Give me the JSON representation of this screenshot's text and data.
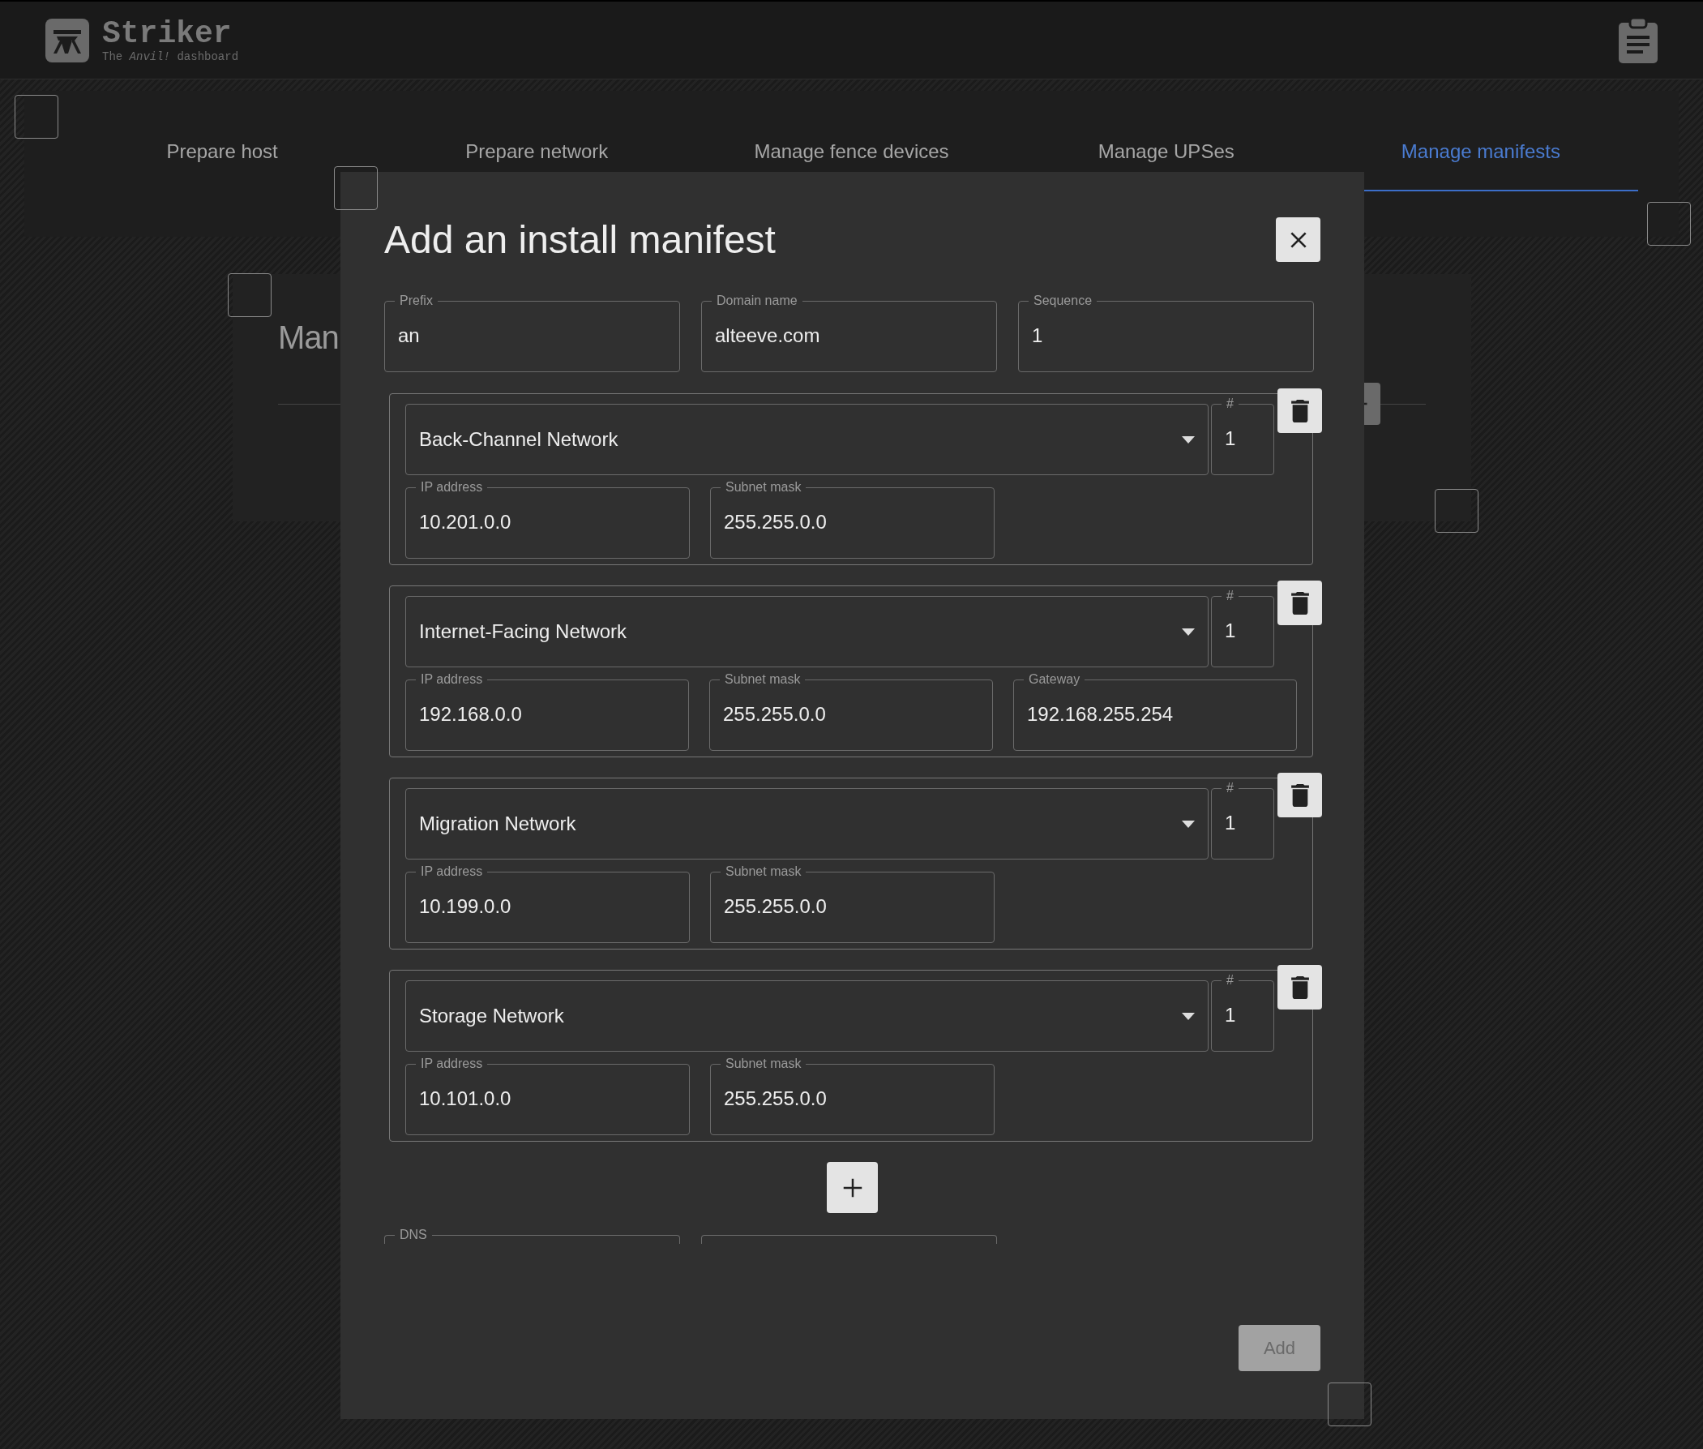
{
  "header": {
    "title": "Striker",
    "subtitle": "The *Anvil!* dashboard"
  },
  "tabs": [
    {
      "label": "Prepare host",
      "selected": false
    },
    {
      "label": "Prepare network",
      "selected": false
    },
    {
      "label": "Manage fence devices",
      "selected": false
    },
    {
      "label": "Manage UPSes",
      "selected": false
    },
    {
      "label": "Manage manifests",
      "selected": true
    }
  ],
  "panel": {
    "title": "Man"
  },
  "dialog": {
    "title": "Add an install manifest",
    "fields": [
      {
        "label": "Prefix",
        "value": "an"
      },
      {
        "label": "Domain name",
        "value": "alteeve.com"
      },
      {
        "label": "Sequence",
        "value": "1"
      }
    ],
    "networks": [
      {
        "type": "Back-Channel Network",
        "number_label": "#",
        "number": "1",
        "fields": [
          {
            "label": "IP address",
            "value": "10.201.0.0"
          },
          {
            "label": "Subnet mask",
            "value": "255.255.0.0"
          }
        ]
      },
      {
        "type": "Internet-Facing Network",
        "number_label": "#",
        "number": "1",
        "fields": [
          {
            "label": "IP address",
            "value": "192.168.0.0"
          },
          {
            "label": "Subnet mask",
            "value": "255.255.0.0"
          },
          {
            "label": "Gateway",
            "value": "192.168.255.254"
          }
        ]
      },
      {
        "type": "Migration Network",
        "number_label": "#",
        "number": "1",
        "fields": [
          {
            "label": "IP address",
            "value": "10.199.0.0"
          },
          {
            "label": "Subnet mask",
            "value": "255.255.0.0"
          }
        ]
      },
      {
        "type": "Storage Network",
        "number_label": "#",
        "number": "1",
        "fields": [
          {
            "label": "IP address",
            "value": "10.101.0.0"
          },
          {
            "label": "Subnet mask",
            "value": "255.255.0.0"
          }
        ]
      }
    ],
    "dns": {
      "label": "DNS"
    },
    "submit": {
      "label": "Add",
      "disabled": true
    }
  }
}
